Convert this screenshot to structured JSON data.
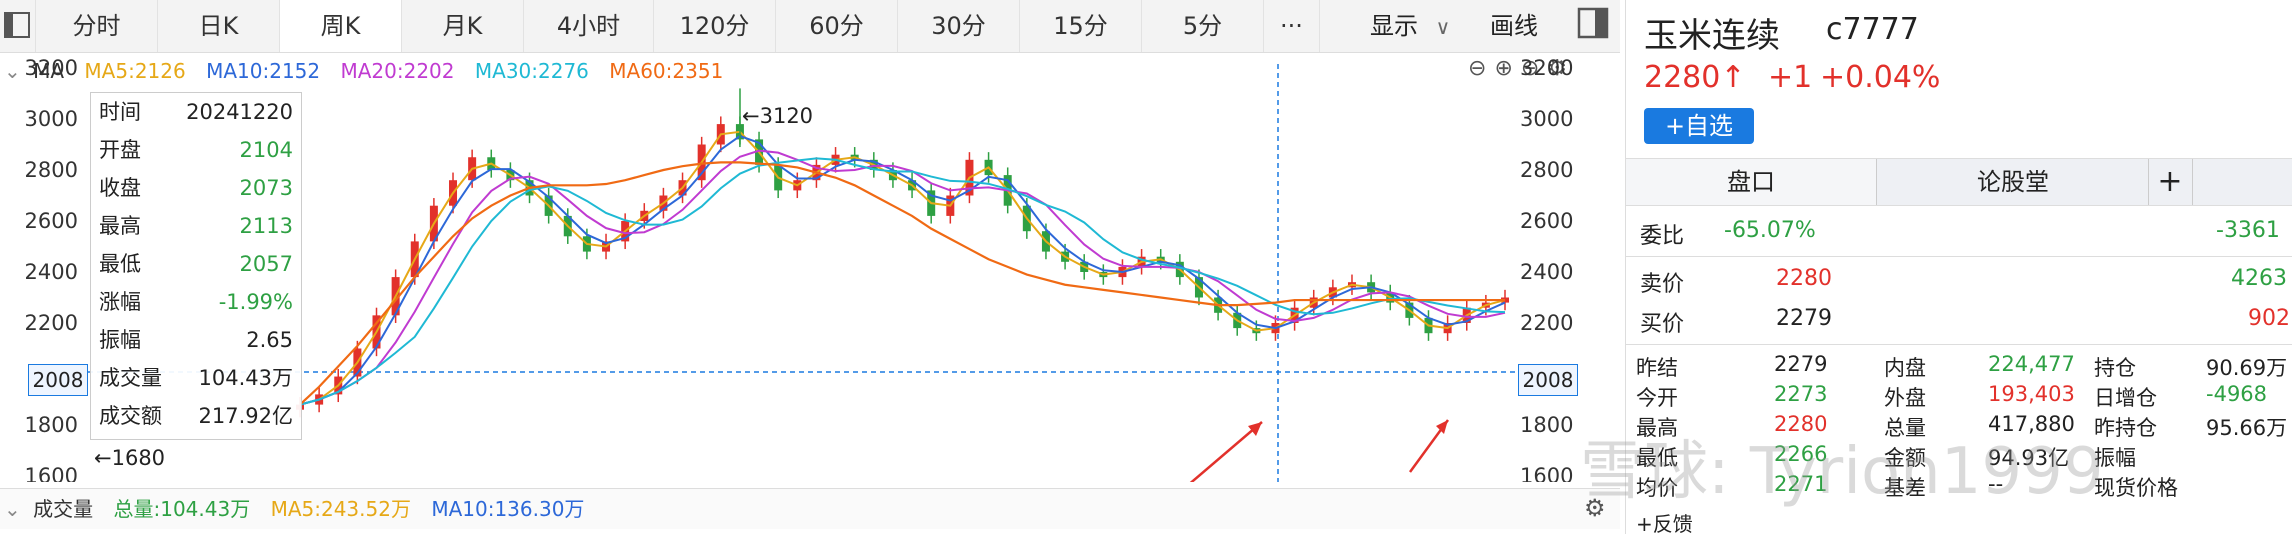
{
  "tabs": [
    {
      "label": "分时"
    },
    {
      "label": "日K"
    },
    {
      "label": "周K"
    },
    {
      "label": "月K"
    },
    {
      "label": "4小时"
    },
    {
      "label": "120分"
    },
    {
      "label": "60分"
    },
    {
      "label": "30分"
    },
    {
      "label": "15分"
    },
    {
      "label": "5分"
    },
    {
      "label": "···"
    }
  ],
  "active_tab": "周K",
  "toolbar": {
    "display_label": "显示",
    "draw_label": "画线"
  },
  "ma_bar": {
    "label": "MA",
    "ma5": "MA5:2126",
    "ma10": "MA10:2152",
    "ma20": "MA20:2202",
    "ma30": "MA30:2276",
    "ma60": "MA60:2351"
  },
  "colors": {
    "ma5": "#e6a817",
    "ma10": "#2d68d8",
    "ma20": "#c03bd1",
    "ma30": "#1fb9d4",
    "ma60": "#f06a14",
    "up": "#e2312b",
    "down": "#2ea043",
    "accent": "#1a7ae0"
  },
  "y_ticks": [
    "3200",
    "3000",
    "2800",
    "2600",
    "2400",
    "2200",
    "1800",
    "1600"
  ],
  "crosshair_value": "2008",
  "annotations": {
    "high": "←3120",
    "low": "←1680"
  },
  "tooltip": {
    "rows": [
      {
        "k": "时间",
        "v": "20241220"
      },
      {
        "k": "开盘",
        "v": "2104"
      },
      {
        "k": "收盘",
        "v": "2073"
      },
      {
        "k": "最高",
        "v": "2113"
      },
      {
        "k": "最低",
        "v": "2057"
      },
      {
        "k": "涨幅",
        "v": "-1.99%"
      },
      {
        "k": "振幅",
        "v": "2.65"
      },
      {
        "k": "成交量",
        "v": "104.43万"
      },
      {
        "k": "成交额",
        "v": "217.92亿"
      }
    ]
  },
  "volume_bar": {
    "label": "成交量",
    "total": "总量:104.43万",
    "ma5": "MA5:243.52万",
    "ma10": "MA10:136.30万"
  },
  "chart_data": {
    "type": "candlestick",
    "ylim": [
      1600,
      3200
    ],
    "close_series": [
      1880,
      1920,
      1990,
      2100,
      2230,
      2380,
      2520,
      2660,
      2760,
      2850,
      2800,
      2760,
      2700,
      2620,
      2540,
      2480,
      2520,
      2600,
      2640,
      2700,
      2760,
      2900,
      2980,
      2920,
      2820,
      2720,
      2760,
      2820,
      2860,
      2840,
      2800,
      2760,
      2720,
      2620,
      2700,
      2840,
      2780,
      2660,
      2560,
      2480,
      2440,
      2400,
      2380,
      2420,
      2460,
      2440,
      2380,
      2300,
      2240,
      2180,
      2160,
      2200,
      2260,
      2300,
      2340,
      2360,
      2320,
      2280,
      2220,
      2160,
      2200,
      2260,
      2280,
      2300
    ],
    "ma60_series": [
      1880,
      1950,
      2030,
      2110,
      2200,
      2290,
      2380,
      2460,
      2540,
      2610,
      2660,
      2700,
      2730,
      2740,
      2740,
      2740,
      2745,
      2760,
      2780,
      2800,
      2815,
      2825,
      2830,
      2830,
      2825,
      2820,
      2810,
      2790,
      2770,
      2740,
      2700,
      2660,
      2620,
      2570,
      2530,
      2490,
      2450,
      2420,
      2390,
      2370,
      2350,
      2340,
      2330,
      2320,
      2310,
      2300,
      2290,
      2280,
      2270,
      2270,
      2275,
      2280,
      2290,
      2290,
      2290,
      2290,
      2290,
      2290,
      2290,
      2290,
      2290,
      2290,
      2290,
      2290
    ]
  },
  "right": {
    "name": "玉米连续",
    "code": "c7777",
    "price": "2280↑",
    "change": "+1",
    "change_pct": "+0.04%",
    "fav_button": "+自选",
    "tab1": "盘口",
    "tab2": "论股堂",
    "plus": "+",
    "weibi_label": "委比",
    "weibi_value": "-65.07%",
    "weibi_right": "-3361",
    "sell_label": "卖价",
    "sell_price": "2280",
    "sell_vol": "4263",
    "buy_label": "买价",
    "buy_price": "2279",
    "buy_vol": "902",
    "stats": [
      {
        "k": "昨结",
        "v": "2279",
        "k2": "内盘",
        "v2": "224,477",
        "k3": "持仓",
        "v3": "90.69万"
      },
      {
        "k": "今开",
        "v": "2273",
        "k2": "外盘",
        "v2": "193,403",
        "k3": "日增仓",
        "v3": "-4968"
      },
      {
        "k": "最高",
        "v": "2280",
        "k2": "总量",
        "v2": "417,880",
        "k3": "昨持仓",
        "v3": "95.66万"
      },
      {
        "k": "最低",
        "v": "2266",
        "k2": "金额",
        "v2": "94.93亿",
        "k3": "振幅",
        "v3": ""
      },
      {
        "k": "均价",
        "v": "2271",
        "k2": "基差",
        "v2": "--",
        "k3": "现货价格",
        "v3": ""
      }
    ],
    "feedback": "+反馈"
  },
  "watermark": "雪球: Tyrion1999"
}
